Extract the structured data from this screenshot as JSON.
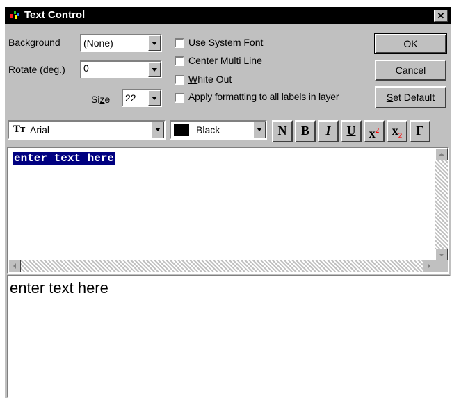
{
  "window": {
    "title": "Text Control"
  },
  "fields": {
    "background_label": "Background",
    "background_value": "(None)",
    "rotate_label": "Rotate (deg.)",
    "rotate_value": "0",
    "size_label": "Size",
    "size_value": "22"
  },
  "options": {
    "use_system_font": "Use System Font",
    "center_multi_line": "Center Multi Line",
    "white_out": "White Out",
    "apply_formatting": "Apply formatting to all labels in layer"
  },
  "buttons": {
    "ok": "OK",
    "cancel": "Cancel",
    "set_default": "Set Default"
  },
  "toolbar": {
    "font_value": "Arial",
    "color_value": "Black",
    "normal": "N",
    "bold": "B",
    "italic": "I",
    "underline": "U",
    "superscript_base": "x",
    "superscript_mark": "2",
    "subscript_base": "x",
    "subscript_mark": "2",
    "greek": "Γ",
    "colors": {
      "swatch": "#000000",
      "accent_red": "#ff0000"
    }
  },
  "editor": {
    "text": "enter text here"
  },
  "preview": {
    "text": "enter text here"
  },
  "icons": [
    "app-icon",
    "close-icon",
    "truetype-font-icon",
    "scroll-up-icon",
    "scroll-down-icon",
    "scroll-left-icon",
    "scroll-right-icon"
  ]
}
